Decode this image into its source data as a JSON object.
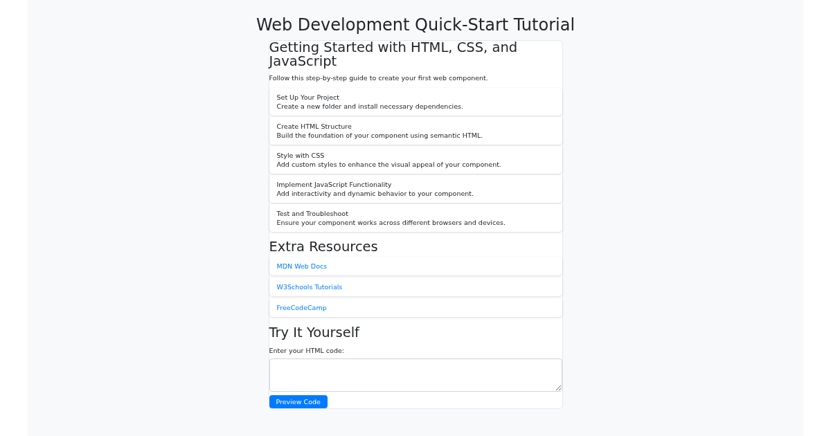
{
  "page_title": "Web Development Quick-Start Tutorial",
  "guide": {
    "title": "Getting Started with HTML, CSS, and JavaScript",
    "description": "Follow this step-by-step guide to create your first web component.",
    "steps": [
      {
        "title": "Set Up Your Project",
        "text": "Create a new folder and install necessary dependencies."
      },
      {
        "title": "Create HTML Structure",
        "text": "Build the foundation of your component using semantic HTML."
      },
      {
        "title": "Style with CSS",
        "text": "Add custom styles to enhance the visual appeal of your component."
      },
      {
        "title": "Implement JavaScript Functionality",
        "text": "Add interactivity and dynamic behavior to your component."
      },
      {
        "title": "Test and Troubleshoot",
        "text": "Ensure your component works across different browsers and devices."
      }
    ]
  },
  "resources": {
    "title": "Extra Resources",
    "links": [
      "MDN Web Docs",
      "W3Schools Tutorials",
      "FreeCodeCamp"
    ]
  },
  "try_it": {
    "title": "Try It Yourself",
    "label": "Enter your HTML code:",
    "button": "Preview Code"
  }
}
